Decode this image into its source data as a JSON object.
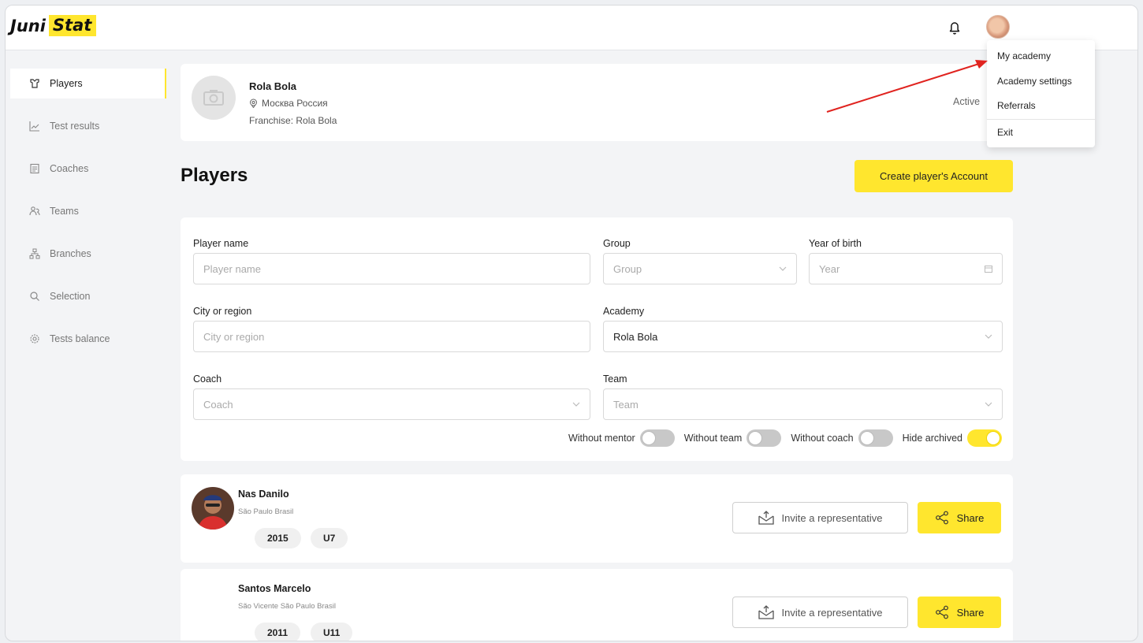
{
  "header": {
    "logo_part1": "Juni",
    "logo_part2": "Stat",
    "bell_icon": "bell-icon",
    "avatar_icon": "user-avatar"
  },
  "user_menu": {
    "items": [
      "My academy",
      "Academy settings",
      "Referrals",
      "Exit"
    ]
  },
  "sidebar": {
    "items": [
      {
        "label": "Players",
        "icon": "player-icon",
        "active": true
      },
      {
        "label": "Test results",
        "icon": "chart-line-icon",
        "active": false
      },
      {
        "label": "Coaches",
        "icon": "clipboard-icon",
        "active": false
      },
      {
        "label": "Teams",
        "icon": "team-icon",
        "active": false
      },
      {
        "label": "Branches",
        "icon": "branches-icon",
        "active": false
      },
      {
        "label": "Selection",
        "icon": "search-icon",
        "active": false
      },
      {
        "label": "Tests balance",
        "icon": "gear-icon",
        "active": false
      }
    ]
  },
  "academy": {
    "name": "Rola Bola",
    "location": "Москва Россия",
    "franchise": "Franchise: Rola Bola",
    "status": "Active"
  },
  "page": {
    "title": "Players",
    "create_button": "Create player's Account"
  },
  "filters": {
    "player_name": {
      "label": "Player name",
      "placeholder": "Player name"
    },
    "group": {
      "label": "Group",
      "placeholder": "Group"
    },
    "year_of_birth": {
      "label": "Year of birth",
      "placeholder": "Year"
    },
    "city": {
      "label": "City or region",
      "placeholder": "City or region"
    },
    "academy": {
      "label": "Academy",
      "value": "Rola Bola"
    },
    "coach": {
      "label": "Coach",
      "placeholder": "Coach"
    },
    "team": {
      "label": "Team",
      "placeholder": "Team"
    },
    "toggles": [
      {
        "label": "Without mentor",
        "on": false
      },
      {
        "label": "Without team",
        "on": false
      },
      {
        "label": "Without coach",
        "on": false
      },
      {
        "label": "Hide archived",
        "on": true
      }
    ]
  },
  "players": [
    {
      "name": "Nas Danilo",
      "location": "São Paulo Brasil",
      "year": "2015",
      "group": "U7",
      "has_photo": true
    },
    {
      "name": "Santos Marcelo",
      "location": "São Vicente São Paulo Brasil",
      "year": "2011",
      "group": "U11",
      "has_photo": false
    }
  ],
  "player_actions": {
    "invite": "Invite a representative",
    "share": "Share"
  },
  "colors": {
    "accent": "#ffe62e",
    "annotation_arrow": "#e0231f"
  }
}
